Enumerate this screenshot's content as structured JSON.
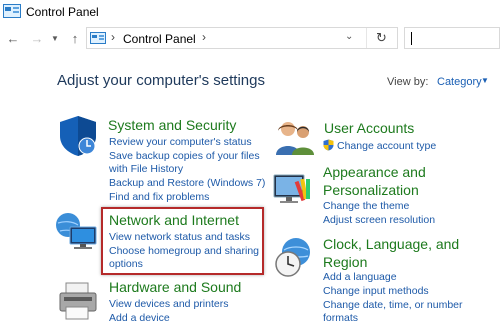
{
  "window": {
    "title": "Control Panel"
  },
  "nav": {
    "back_icon": "arrow-left-icon",
    "forward_icon": "arrow-right-icon",
    "recent_icon": "chevron-down-icon",
    "up_icon": "arrow-up-icon",
    "breadcrumb": "Control Panel",
    "refresh_icon": "refresh-icon",
    "search_placeholder": ""
  },
  "main": {
    "heading": "Adjust your computer's settings",
    "view_by_label": "View by:",
    "view_by_value": "Category"
  },
  "categories": {
    "system_security": {
      "title": "System and Security",
      "icon": "shield-icon",
      "links": [
        "Review your computer's status",
        "Save backup copies of your files",
        "with File History",
        "Backup and Restore (Windows 7)",
        "Find and fix problems"
      ]
    },
    "network": {
      "title": "Network and Internet",
      "icon": "network-globe-icon",
      "links": [
        "View network status and tasks",
        "Choose homegroup and sharing",
        "options"
      ]
    },
    "hardware": {
      "title": "Hardware and Sound",
      "icon": "printer-icon",
      "links": [
        "View devices and printers",
        "Add a device"
      ]
    },
    "user_accounts": {
      "title": "User Accounts",
      "icon": "users-icon",
      "links": [
        "Change account type"
      ]
    },
    "appearance": {
      "title_line1": "Appearance and",
      "title_line2": "Personalization",
      "icon": "monitor-palette-icon",
      "links": [
        "Change the theme",
        "Adjust screen resolution"
      ]
    },
    "clock": {
      "title_line1": "Clock, Language, and",
      "title_line2": "Region",
      "icon": "clock-globe-icon",
      "links": [
        "Add a language",
        "Change input methods",
        "Change date, time, or number",
        "formats"
      ]
    }
  },
  "colors": {
    "category_title": "#1d7a1d",
    "link": "#1e5aa8",
    "heading": "#1e395b",
    "highlight_border": "#b52a2a"
  }
}
